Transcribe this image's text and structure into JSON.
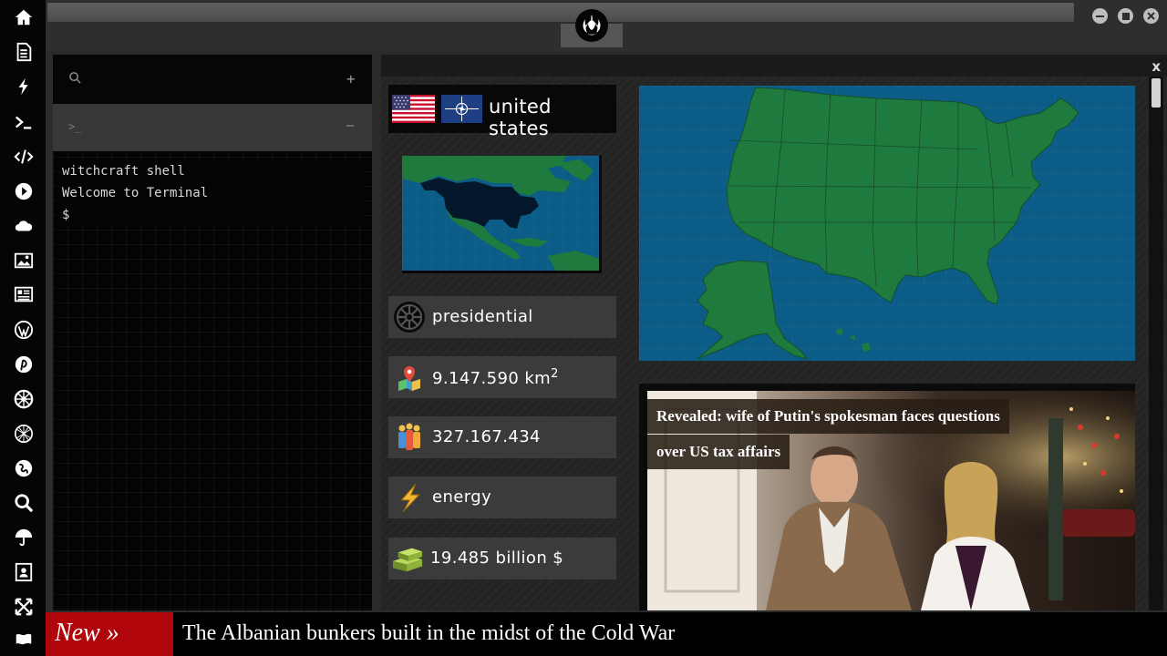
{
  "sidebar": {
    "icons": [
      "home-icon",
      "document-icon",
      "lightning-icon",
      "terminal-icon",
      "code-icon",
      "play-icon",
      "cloud-icon",
      "image-icon",
      "newspaper-icon",
      "wordpress-icon",
      "pinterest-icon",
      "empire-icon",
      "network-icon",
      "globe-icon",
      "search-icon",
      "umbrella-icon",
      "contact-icon",
      "expand-icon",
      "flag-icon"
    ]
  },
  "terminal": {
    "search_icon": "search-icon",
    "add_label": "+",
    "prompt_tab_label": ">_",
    "minimize_label": "–",
    "lines": [
      "witchcraft shell",
      "Welcome to Terminal",
      "$"
    ]
  },
  "country": {
    "name": "united states",
    "government": "presidential",
    "area": "9.147.590 km",
    "area_unit_sup": "2",
    "population": "327.167.434",
    "resource": "energy",
    "gdp": "19.485 billion $"
  },
  "news": {
    "headline_line1": "Revealed: wife of Putin's spokesman faces questions",
    "headline_line2": "over US tax affairs"
  },
  "panel": {
    "close_label": "x"
  },
  "ticker": {
    "label": "New »",
    "text": "The Albanian bunkers built in the midst of the Cold War"
  },
  "colors": {
    "map_ocean": "#0b5c86",
    "map_land": "#1f7a3e",
    "ticker_red": "#b0050b"
  }
}
